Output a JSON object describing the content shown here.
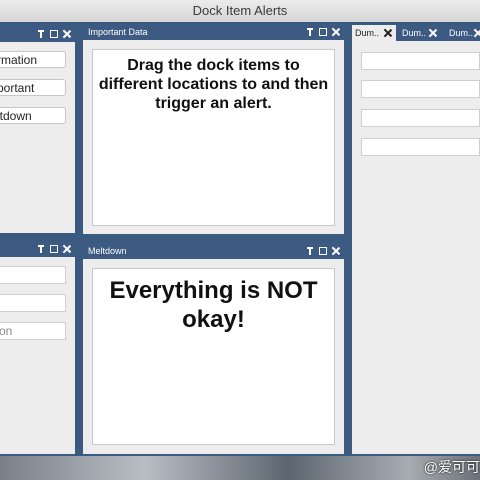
{
  "window": {
    "title": "Dock Item Alerts"
  },
  "left_top": {
    "buttons": [
      "rmation",
      "portant",
      "ltdown"
    ]
  },
  "left_bottom": {
    "fields": [
      "",
      "",
      "on"
    ]
  },
  "important_panel": {
    "title": "Important Data",
    "message": "Drag the dock items to different locations to and then trigger an alert."
  },
  "meltdown_panel": {
    "title": "Meltdown",
    "message": "Everything is NOT okay!"
  },
  "right_panel": {
    "tabs": [
      "Dum..",
      "Dum..",
      "Dum.."
    ]
  },
  "watermark": "@爱可可"
}
